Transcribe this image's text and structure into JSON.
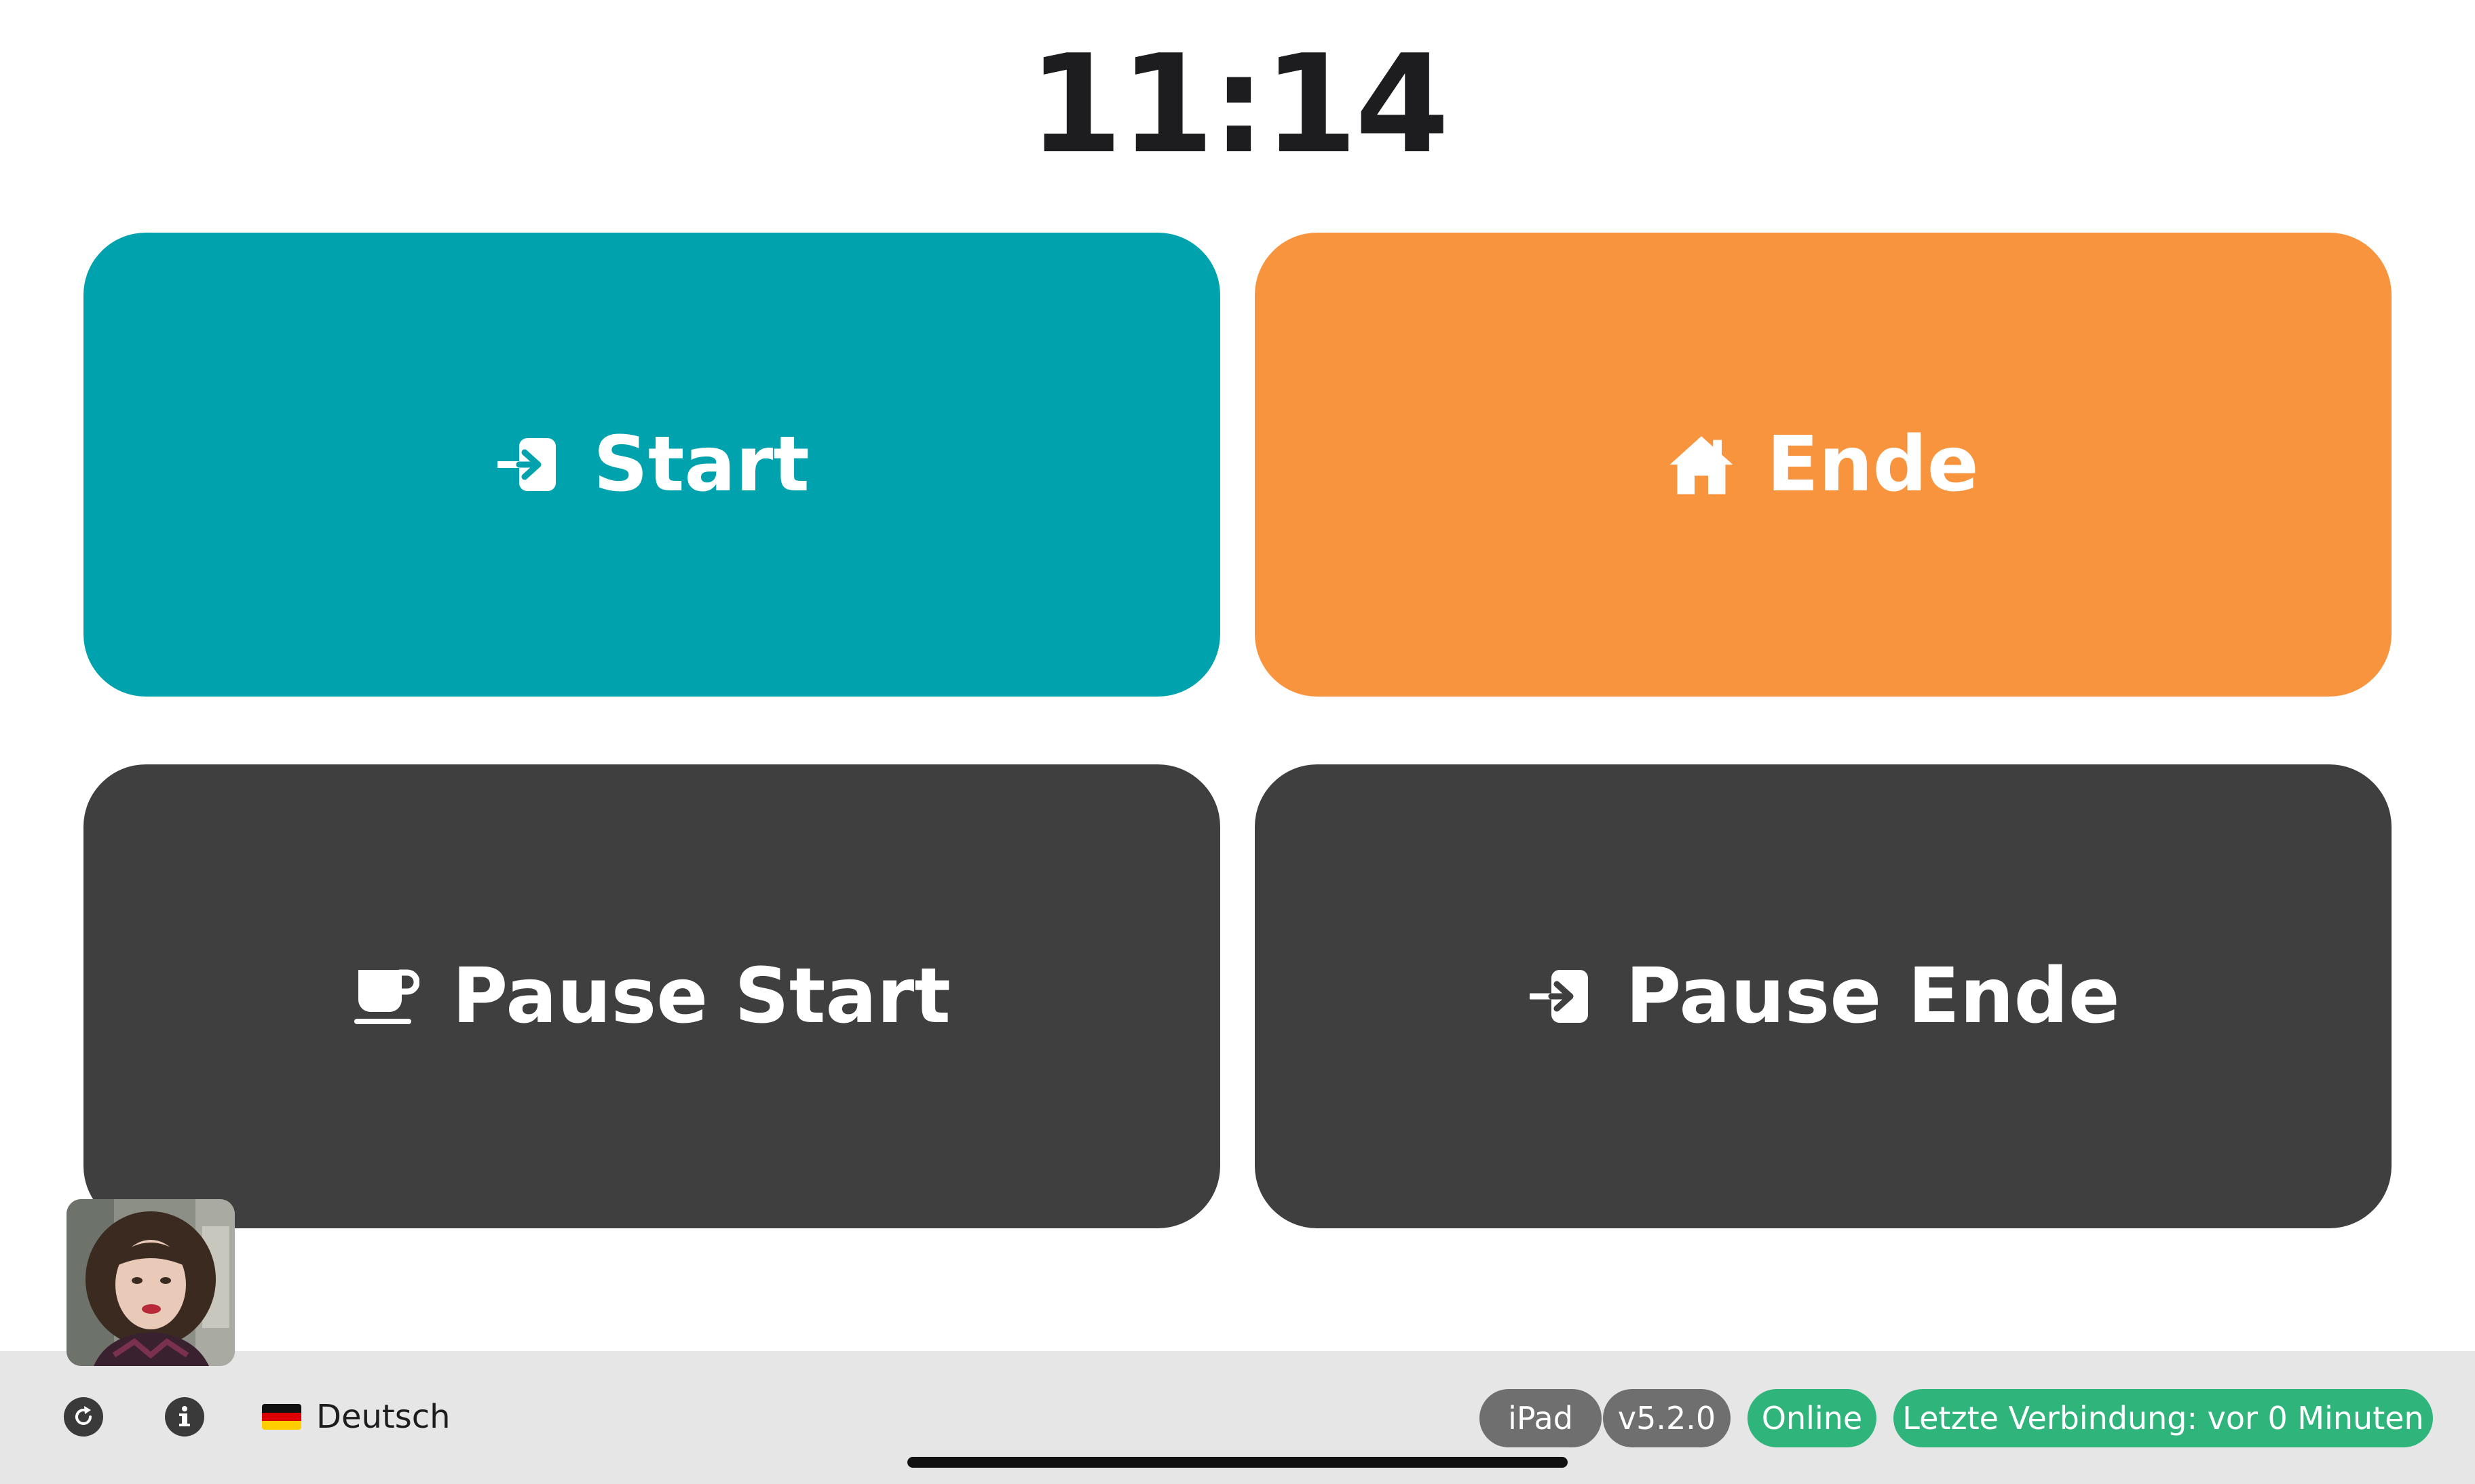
{
  "clock": {
    "time": "11:14"
  },
  "actions": [
    {
      "label": "Start",
      "icon": "sign-in-icon",
      "color": "#00a3ad"
    },
    {
      "label": "Ende",
      "icon": "home-icon",
      "color": "#f9943e"
    },
    {
      "label": "Pause Start",
      "icon": "coffee-cup-icon",
      "color": "#3f3f3f"
    },
    {
      "label": "Pause Ende",
      "icon": "sign-in-icon",
      "color": "#3f3f3f"
    }
  ],
  "user": {
    "avatar": "user-avatar"
  },
  "footer": {
    "refresh_icon": "refresh-icon",
    "info_icon": "info-icon",
    "language": {
      "flag": "german-flag-icon",
      "label": "Deutsch"
    },
    "badges": {
      "device": "iPad",
      "version": "v5.2.0",
      "status": "Online",
      "last_connection": "Letzte Verbindung: vor 0 Minuten"
    },
    "badge_colors": {
      "neutral": "#6f6f6f",
      "success": "#2fb57b"
    }
  }
}
